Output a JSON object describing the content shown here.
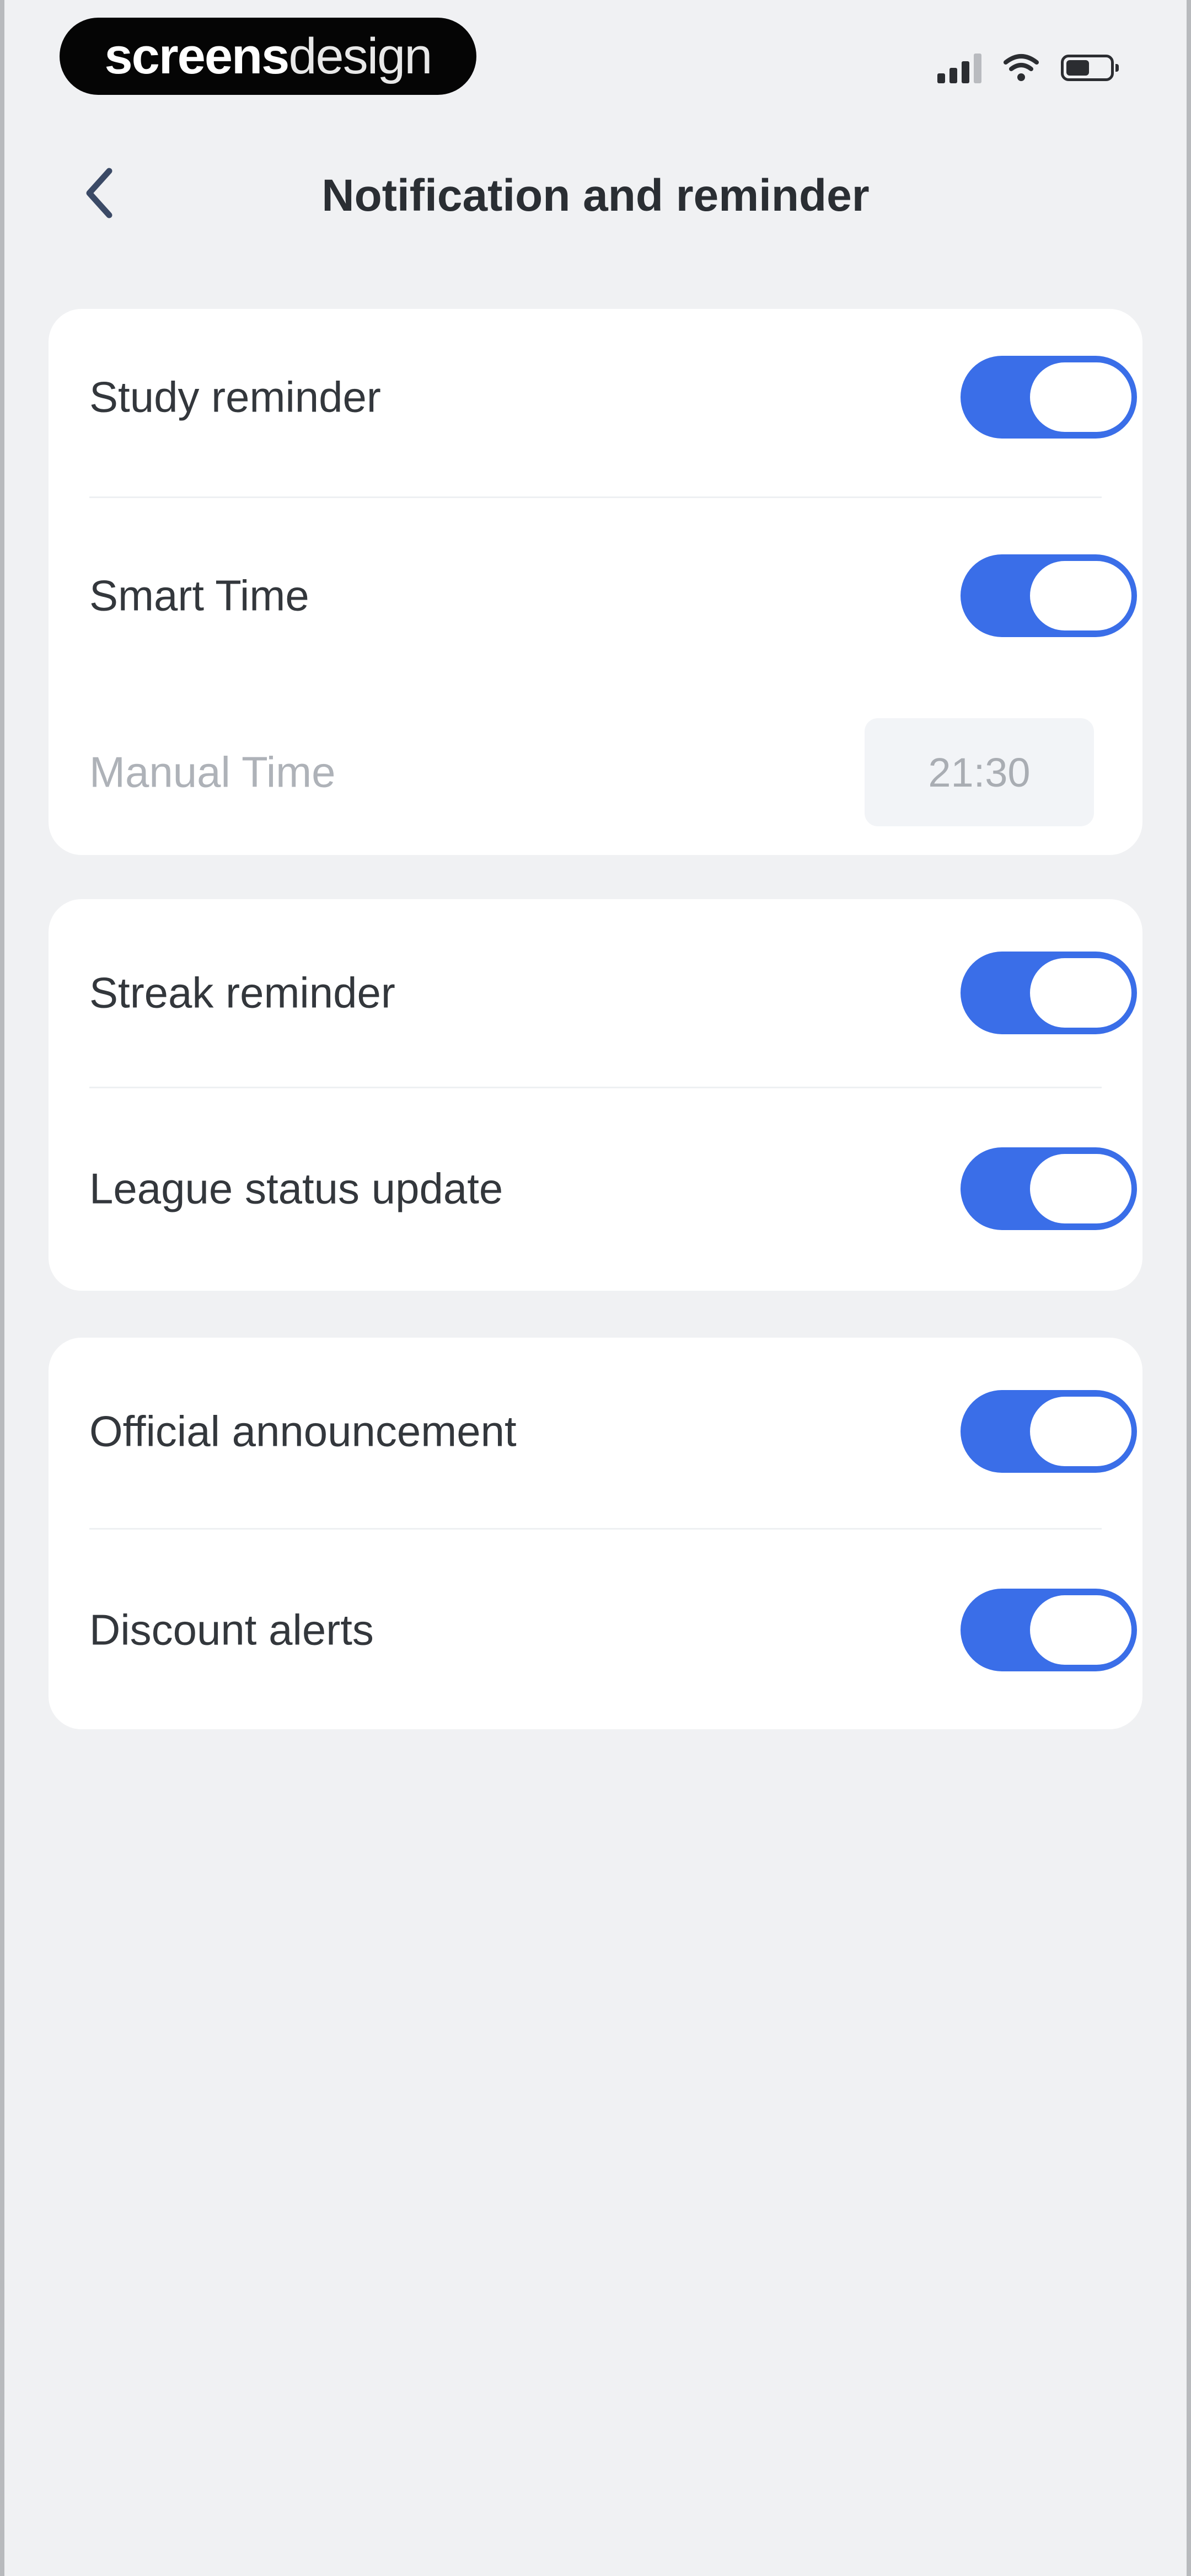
{
  "status_bar": {
    "brand_bold": "screens",
    "brand_light": "design",
    "icons": [
      "signal-icon",
      "wifi-icon",
      "battery-icon"
    ]
  },
  "header": {
    "back_icon": "chevron-left-icon",
    "title": "Notification and reminder"
  },
  "colors": {
    "accent": "#3a6ee8",
    "background": "#f0f1f3",
    "card": "#ffffff"
  },
  "groups": [
    {
      "items": [
        {
          "label": "Study reminder",
          "toggle_on": true
        },
        {
          "label": "Smart Time",
          "toggle_on": true
        },
        {
          "label": "Manual Time",
          "value": "21:30"
        }
      ]
    },
    {
      "items": [
        {
          "label": "Streak reminder",
          "toggle_on": true
        },
        {
          "label": "League status update",
          "toggle_on": true
        }
      ]
    },
    {
      "items": [
        {
          "label": "Official announcement",
          "toggle_on": true
        },
        {
          "label": "Discount alerts",
          "toggle_on": true
        }
      ]
    }
  ]
}
